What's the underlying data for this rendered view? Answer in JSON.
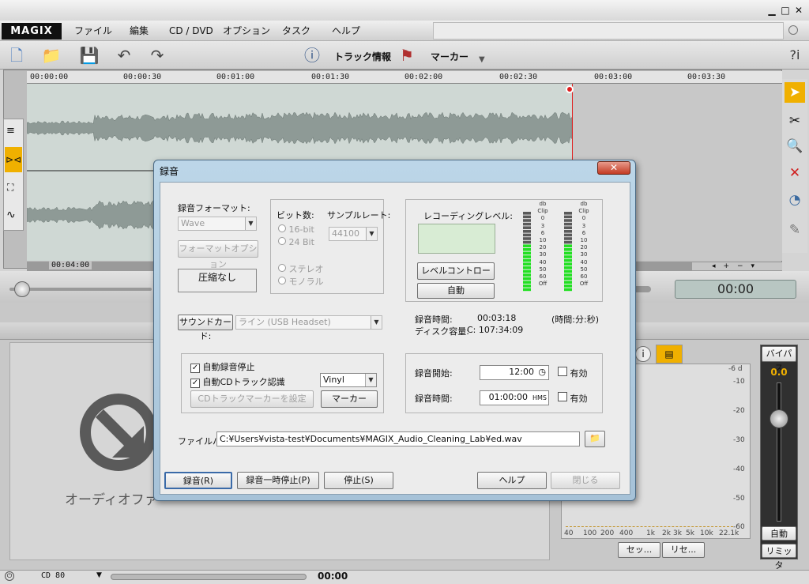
{
  "app": {
    "logo": "MAGIX"
  },
  "menu": [
    "ファイル",
    "編集",
    "CD / DVD",
    "オプション",
    "タスク",
    "ヘルプ"
  ],
  "toolbar": {
    "track_info": "トラック情報",
    "marker": "マーカー"
  },
  "ruler": [
    "00:00:00",
    "00:00:30",
    "00:01:00",
    "00:01:30",
    "00:02:00",
    "00:02:30",
    "00:03:00",
    "00:03:30"
  ],
  "scroll_time": "00:04:00",
  "transport": {
    "time": "00:00"
  },
  "dropzone": {
    "label": "オーディオファ"
  },
  "spectrum": {
    "db_labels": [
      "-6 d",
      "-10",
      "-20",
      "-30",
      "-40",
      "-50",
      "-60"
    ],
    "freq_labels": [
      "40",
      "100",
      "200",
      "400",
      "1k",
      "2k",
      "3k",
      "5k",
      "10k",
      "22.1k"
    ],
    "btn_set": "セッ...",
    "btn_reset": "リセ..."
  },
  "bypass": {
    "title": "バイパス",
    "value": "0.0",
    "auto": "自動",
    "limiter": "リミッタ"
  },
  "status": {
    "cd": "CD 80",
    "time": "00:00"
  },
  "dialog": {
    "title": "録音",
    "format_label": "録音フォーマット:",
    "format_value": "Wave",
    "format_option_btn": "フォーマットオプション",
    "compression": "圧縮なし",
    "bit_label": "ビット数:",
    "bit_16": "16-bit",
    "bit_24": "24 Bit",
    "samplerate_label": "サンプルレート:",
    "samplerate_value": "44100",
    "stereo": "ステレオ",
    "mono": "モノラル",
    "rec_level_label": "レコーディングレベル:",
    "level_control_btn": "レベルコントロール",
    "auto_btn": "自動",
    "meter_scale": [
      "db",
      "Clip",
      "0",
      "3",
      "6",
      "10",
      "20",
      "30",
      "40",
      "50",
      "60",
      "Off"
    ],
    "soundcard_btn": "サウンドカード:",
    "soundcard_value": "ライン (USB Headset)",
    "rec_time_label": "録音時間:",
    "rec_time_value": "00:03:18",
    "time_unit": "(時間:分:秒)",
    "disk_label": "ディスク容量:",
    "disk_value": "C: 107:34:09",
    "auto_stop": "自動録音停止",
    "auto_cd": "自動CDトラック認識",
    "vinyl": "Vinyl",
    "cd_marker_btn": "CDトラックマーカーを設定",
    "marker_btn": "マーカー",
    "start_label": "録音開始:",
    "start_value": "12:00",
    "duration_label": "録音時間:",
    "duration_value": "01:00:00",
    "duration_unit": "HMS",
    "valid": "有効",
    "filepath_label": "ファイルパス",
    "filepath_value": "C:¥Users¥vista-test¥Documents¥MAGIX_Audio_Cleaning_Lab¥ed.wav",
    "record_btn": "録音(R)",
    "pause_btn": "録音一時停止(P)",
    "stop_btn": "停止(S)",
    "help_btn": "ヘルプ",
    "close_btn": "閉じる"
  }
}
